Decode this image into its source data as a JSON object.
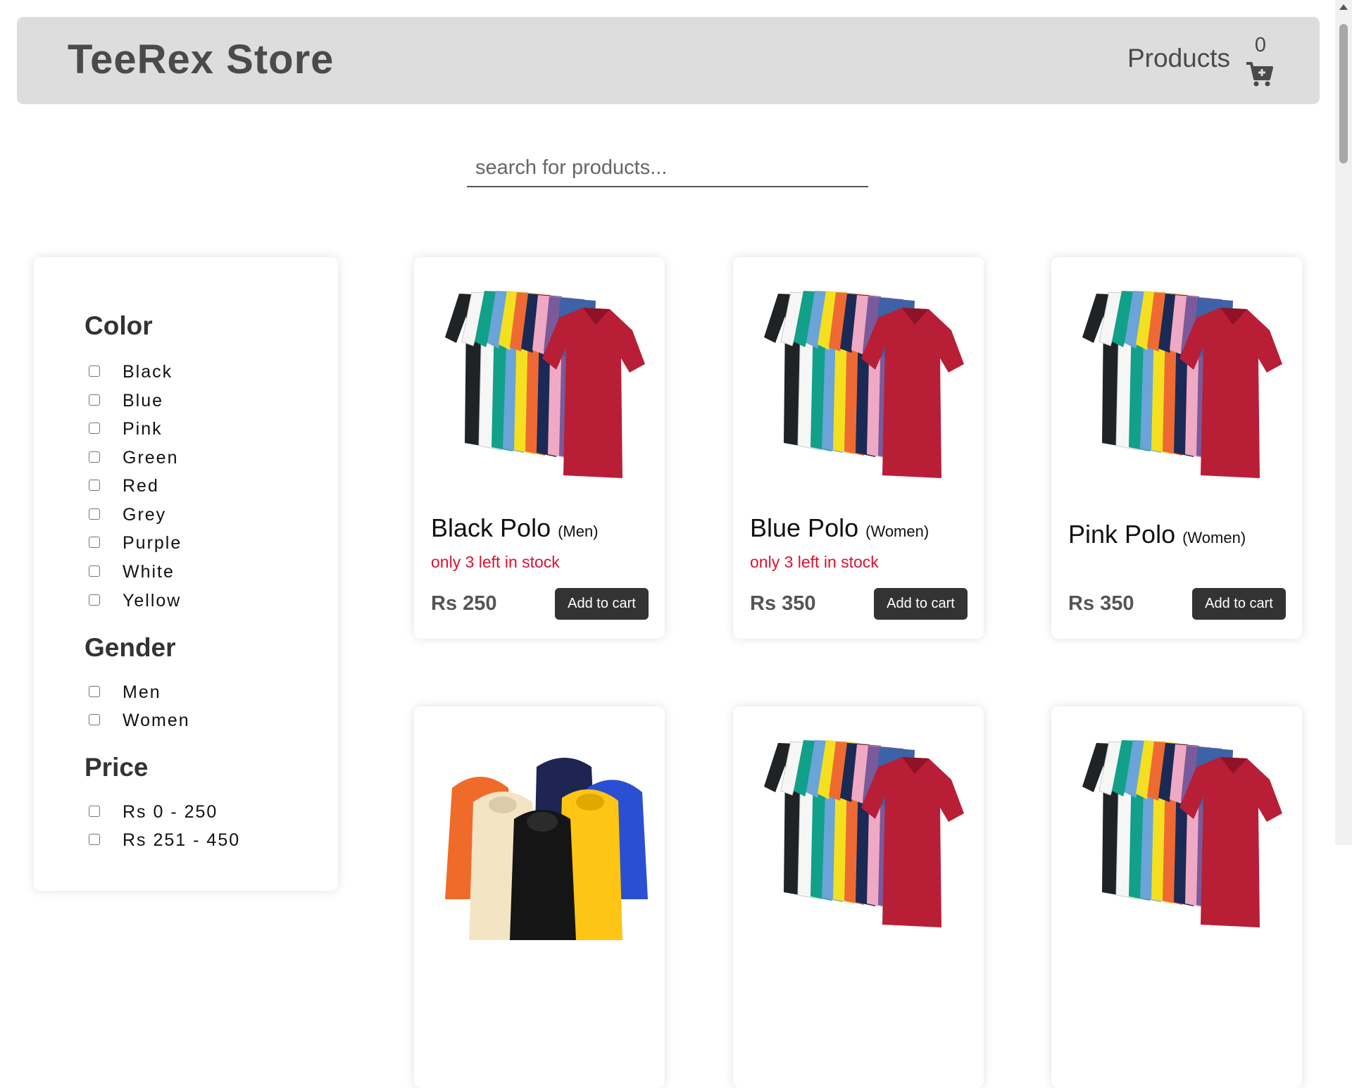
{
  "header": {
    "brand": "TeeRex Store",
    "nav_products": "Products",
    "cart_count": "0",
    "cart_icon": "add-to-cart-icon"
  },
  "search": {
    "placeholder": "search for products...",
    "value": ""
  },
  "filters": {
    "color": {
      "title": "Color",
      "options": [
        "Black",
        "Blue",
        "Pink",
        "Green",
        "Red",
        "Grey",
        "Purple",
        "White",
        "Yellow"
      ]
    },
    "gender": {
      "title": "Gender",
      "options": [
        "Men",
        "Women"
      ]
    },
    "price": {
      "title": "Price",
      "options": [
        "Rs 0 - 250",
        "Rs 251 - 450"
      ]
    }
  },
  "products": [
    {
      "name": "Black Polo",
      "gender": "(Men)",
      "stock_note": "only 3 left in stock",
      "price": "Rs 250",
      "button": "Add to cart",
      "image": "polo-shirts"
    },
    {
      "name": "Blue Polo",
      "gender": "(Women)",
      "stock_note": "only 3 left in stock",
      "price": "Rs 350",
      "button": "Add to cart",
      "image": "polo-shirts"
    },
    {
      "name": "Pink Polo",
      "gender": "(Women)",
      "stock_note": "",
      "price": "Rs 350",
      "button": "Add to cart",
      "image": "polo-shirts"
    },
    {
      "image": "hoodies"
    },
    {
      "image": "polo-shirts"
    },
    {
      "image": "polo-shirts"
    }
  ],
  "colors": {
    "header_bg": "#dddddd",
    "button_bg": "#333333",
    "stock_warning": "#e0102e"
  }
}
